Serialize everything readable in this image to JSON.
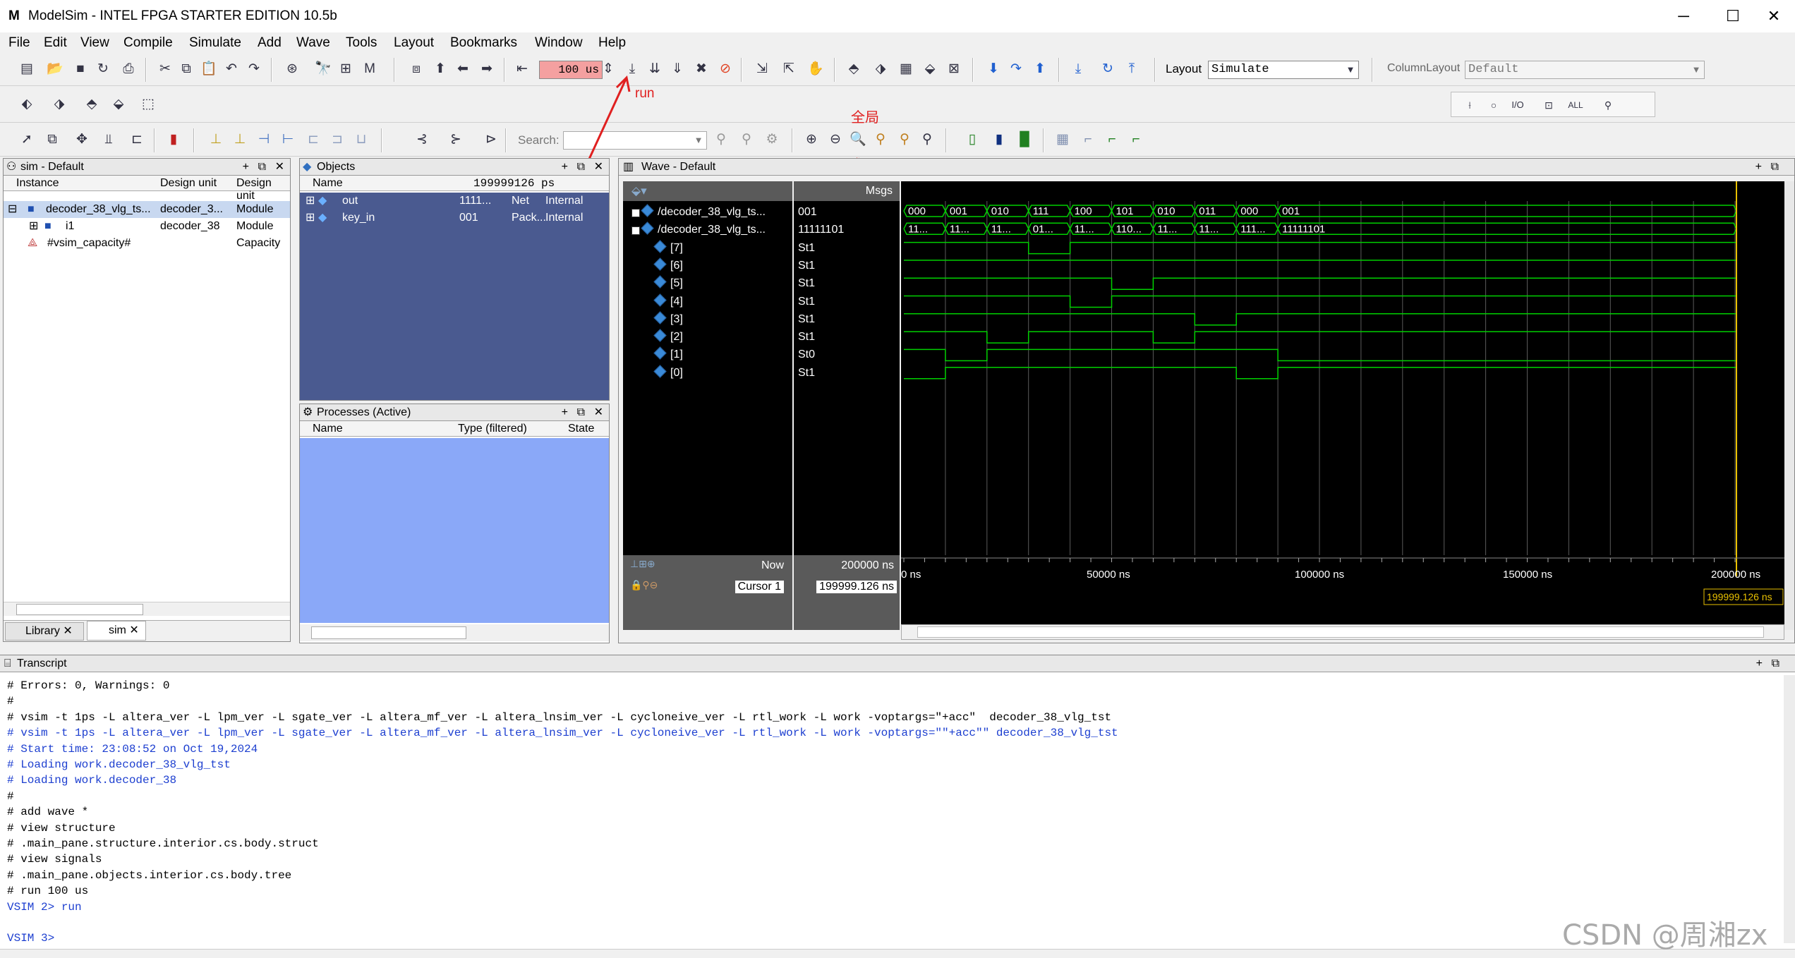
{
  "app": {
    "title": "ModelSim - INTEL FPGA STARTER EDITION 10.5b",
    "win_min": "─",
    "win_max": "☐",
    "win_close": "✕"
  },
  "menu": [
    "File",
    "Edit",
    "View",
    "Compile",
    "Simulate",
    "Add",
    "Wave",
    "Tools",
    "Layout",
    "Bookmarks",
    "Window",
    "Help"
  ],
  "toolbar": {
    "run_length": "100 us",
    "layout_label": "Layout",
    "layout_value": "Simulate",
    "column_layout_label": "ColumnLayout",
    "column_layout_value": "Default",
    "search_label": "Search:",
    "search_value": ""
  },
  "annotations": {
    "run": "run",
    "fullview": "全局"
  },
  "sim_panel": {
    "title": "sim - Default",
    "columns": [
      "Instance",
      "Design unit",
      "Design unit"
    ],
    "rows": [
      {
        "name": "decoder_38_vlg_ts...",
        "unit": "decoder_3...",
        "type": "Module"
      },
      {
        "name": "i1",
        "unit": "decoder_38",
        "type": "Module"
      },
      {
        "name": "#vsim_capacity#",
        "unit": "",
        "type": "Capacity"
      }
    ],
    "tabs": [
      "Library",
      "sim"
    ]
  },
  "objects_panel": {
    "title": "Objects",
    "time": "199999126 ps",
    "columns": [
      "Name"
    ],
    "rows": [
      {
        "name": "out",
        "value": "1111...",
        "kind": "Net",
        "mode": "Internal"
      },
      {
        "name": "key_in",
        "value": "001",
        "kind": "Pack...",
        "mode": "Internal"
      }
    ]
  },
  "processes_panel": {
    "title": "Processes (Active)",
    "columns": [
      "Name",
      "Type (filtered)",
      "State"
    ]
  },
  "wave": {
    "title": "Wave - Default",
    "msgs": "Msgs",
    "signals": [
      {
        "name": "/decoder_38_vlg_ts...",
        "val": "001"
      },
      {
        "name": "/decoder_38_vlg_ts...",
        "val": "11111101"
      },
      {
        "name": "[7]",
        "val": "St1"
      },
      {
        "name": "[6]",
        "val": "St1"
      },
      {
        "name": "[5]",
        "val": "St1"
      },
      {
        "name": "[4]",
        "val": "St1"
      },
      {
        "name": "[3]",
        "val": "St1"
      },
      {
        "name": "[2]",
        "val": "St1"
      },
      {
        "name": "[1]",
        "val": "St0"
      },
      {
        "name": "[0]",
        "val": "St1"
      }
    ],
    "bus1": [
      "000",
      "001",
      "010",
      "111",
      "100",
      "101",
      "010",
      "011",
      "000",
      "001"
    ],
    "bus2": [
      "11...",
      "11...",
      "11...",
      "01...",
      "11...",
      "110...",
      "11...",
      "11...",
      "111...",
      "11111101"
    ],
    "now_label": "Now",
    "now_value": "200000 ns",
    "cursor_label": "Cursor 1",
    "cursor_value": "199999.126 ns",
    "axis": [
      "0 ns",
      "50000 ns",
      "100000 ns",
      "150000 ns",
      "200000 ns"
    ],
    "cursor_flag": "199999.126 ns"
  },
  "transcript": {
    "title": "Transcript",
    "lines": [
      {
        "t": "# Errors: 0, Warnings: 0",
        "c": ""
      },
      {
        "t": "#",
        "c": ""
      },
      {
        "t": "# vsim -t 1ps -L altera_ver -L lpm_ver -L sgate_ver -L altera_mf_ver -L altera_lnsim_ver -L cycloneive_ver -L rtl_work -L work -voptargs=\"+acc\"  decoder_38_vlg_tst",
        "c": ""
      },
      {
        "t": "# vsim -t 1ps -L altera_ver -L lpm_ver -L sgate_ver -L altera_mf_ver -L altera_lnsim_ver -L cycloneive_ver -L rtl_work -L work -voptargs=\"\"+acc\"\" decoder_38_vlg_tst",
        "c": "blue"
      },
      {
        "t": "# Start time: 23:08:52 on Oct 19,2024",
        "c": "blue"
      },
      {
        "t": "# Loading work.decoder_38_vlg_tst",
        "c": "blue"
      },
      {
        "t": "# Loading work.decoder_38",
        "c": "blue"
      },
      {
        "t": "#",
        "c": ""
      },
      {
        "t": "# add wave *",
        "c": ""
      },
      {
        "t": "# view structure",
        "c": ""
      },
      {
        "t": "# .main_pane.structure.interior.cs.body.struct",
        "c": ""
      },
      {
        "t": "# view signals",
        "c": ""
      },
      {
        "t": "# .main_pane.objects.interior.cs.body.tree",
        "c": ""
      },
      {
        "t": "# run 100 us",
        "c": ""
      },
      {
        "t": "VSIM 2> run",
        "c": "blue"
      },
      {
        "t": "",
        "c": ""
      },
      {
        "t": "VSIM 3>",
        "c": "blue"
      }
    ]
  },
  "watermark": "CSDN @周湘zx"
}
